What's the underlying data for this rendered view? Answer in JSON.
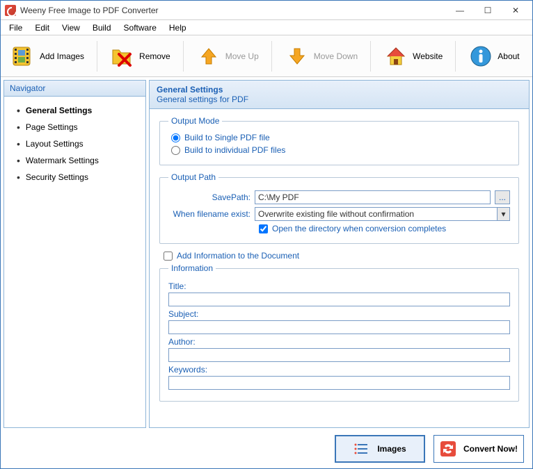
{
  "window": {
    "title": "Weeny Free Image to PDF Converter",
    "min": "—",
    "max": "☐",
    "close": "✕"
  },
  "menu": [
    "File",
    "Edit",
    "View",
    "Build",
    "Software",
    "Help"
  ],
  "toolbar": {
    "add": "Add Images",
    "remove": "Remove",
    "moveup": "Move Up",
    "movedown": "Move Down",
    "website": "Website",
    "about": "About"
  },
  "sidebar": {
    "header": "Navigator",
    "items": [
      {
        "label": "General Settings",
        "active": true
      },
      {
        "label": "Page Settings",
        "active": false
      },
      {
        "label": "Layout Settings",
        "active": false
      },
      {
        "label": "Watermark Settings",
        "active": false
      },
      {
        "label": "Security Settings",
        "active": false
      }
    ]
  },
  "main": {
    "title": "General Settings",
    "subtitle": "General settings for PDF",
    "output_mode": {
      "legend": "Output Mode",
      "opt1": "Build to Single PDF file",
      "opt2": "Build to individual PDF files"
    },
    "output_path": {
      "legend": "Output Path",
      "savepath_label": "SavePath:",
      "savepath_value": "C:\\My PDF",
      "browse": "...",
      "exist_label": "When filename exist:",
      "exist_value": "Overwrite existing file without confirmation",
      "opendir": "Open the directory when conversion completes"
    },
    "addinfo": "Add Information to the Document",
    "information": {
      "legend": "Information",
      "title_label": "Title:",
      "subject_label": "Subject:",
      "author_label": "Author:",
      "keywords_label": "Keywords:",
      "title_val": "",
      "subject_val": "",
      "author_val": "",
      "keywords_val": ""
    }
  },
  "footer": {
    "images": "Images",
    "convert": "Convert Now!"
  }
}
